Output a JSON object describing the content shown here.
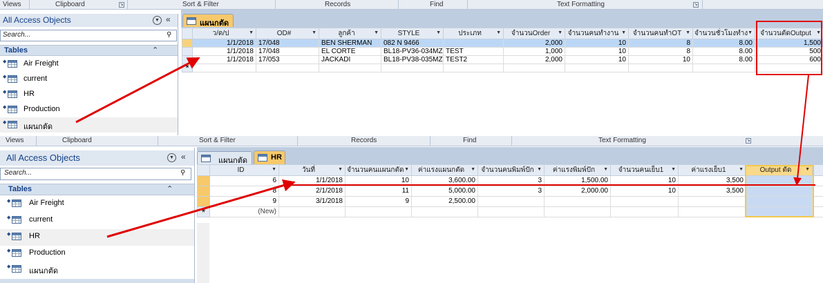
{
  "top": {
    "ribbon_groups": [
      "Views",
      "Clipboard",
      "Sort & Filter",
      "Records",
      "Find",
      "Text Formatting"
    ],
    "nav": {
      "title": "All Access Objects",
      "search_placeholder": "Search...",
      "section": "Tables",
      "items": [
        "Air Freight",
        "current",
        "HR",
        "Production",
        "แผนกตัด"
      ]
    },
    "tab": "แผนกตัด",
    "columns": [
      "ว/ด/ป",
      "OD#",
      "ลูกค้า",
      "STYLE",
      "ประเภท",
      "จำนวนOrder",
      "จำนวนคนทำงาน",
      "จำนวนคนทำOT",
      "จำนวนชั่วโมงทำง",
      "จำนวนตัดOutput"
    ],
    "rows": [
      [
        "1/1/2018",
        "17/048",
        "BEN SHERMAN",
        "082 N 9466",
        "",
        "2,000",
        "10",
        "8",
        "8.00",
        "1,500"
      ],
      [
        "1/1/2018",
        "17/048",
        "EL CORTE",
        "BL18-PV36-034MZ",
        "TEST",
        "1,000",
        "10",
        "8",
        "8.00",
        "500"
      ],
      [
        "1/1/2018",
        "17/053",
        "JACKADI",
        "BL18-PV38-035MZ",
        "TEST2",
        "2,000",
        "10",
        "10",
        "8.00",
        "600"
      ]
    ],
    "new_row_marker": "*"
  },
  "bottom": {
    "ribbon_groups": [
      "Views",
      "Clipboard",
      "Sort & Filter",
      "Records",
      "Find",
      "Text Formatting"
    ],
    "nav": {
      "title": "All Access Objects",
      "search_placeholder": "Search...",
      "section": "Tables",
      "items": [
        "Air Freight",
        "current",
        "HR",
        "Production",
        "แผนกตัด"
      ]
    },
    "tabs": [
      "แผนกตัด",
      "HR"
    ],
    "columns": [
      "ID",
      "วันที่",
      "จำนวนคนแผนกตัด",
      "ค่าแรงแผนกตัด",
      "จำนวนคนพิมพ์ปัก",
      "ค่าแรงพิมพ์ปัก",
      "จำนวนคนเย็บ1",
      "ค่าแรงเย็บ1",
      "Output ตัด"
    ],
    "rows": [
      [
        "6",
        "1/1/2018",
        "10",
        "3,600.00",
        "3",
        "1,500.00",
        "10",
        "3,500",
        ""
      ],
      [
        "8",
        "2/1/2018",
        "11",
        "5,000.00",
        "3",
        "2,000.00",
        "10",
        "3,500",
        ""
      ],
      [
        "9",
        "3/1/2018",
        "9",
        "2,500.00",
        "",
        "",
        "",
        "",
        ""
      ]
    ],
    "new_row": [
      "(New)"
    ],
    "new_row_marker": "*"
  },
  "colors": {
    "annotation_red": "#e00000",
    "highlight_yellow": "#f3c94d",
    "access_blue": "#15428b"
  }
}
